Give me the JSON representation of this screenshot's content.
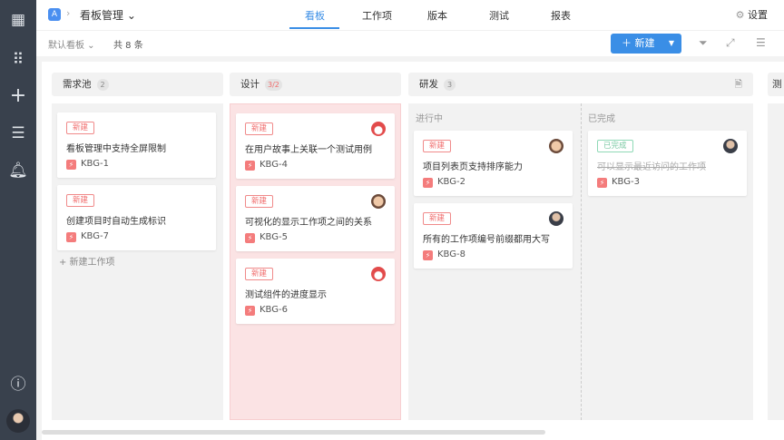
{
  "sidebar": {
    "items": [
      "dashboard-icon",
      "apps-icon",
      "add-icon",
      "list-icon",
      "bell-icon",
      "help-icon"
    ]
  },
  "header": {
    "logo": "A",
    "title": "看板管理",
    "tabs": [
      "看板",
      "工作项",
      "版本",
      "测试",
      "报表"
    ],
    "settings": "设置"
  },
  "toolbar": {
    "view": "默认看板",
    "count": "共 8 条",
    "new": "新建"
  },
  "columns": [
    {
      "title": "需求池",
      "badge": "2",
      "add": "+ 新建工作项",
      "cards": [
        {
          "status": "新建",
          "title": "看板管理中支持全屏限制",
          "id": "KBG-1"
        },
        {
          "status": "新建",
          "title": "创建项目时自动生成标识",
          "id": "KBG-7"
        }
      ]
    },
    {
      "title": "设计",
      "badge": "3/2",
      "cards": [
        {
          "status": "新建",
          "title": "在用户故事上关联一个测试用例",
          "id": "KBG-4"
        },
        {
          "status": "新建",
          "title": "可视化的显示工作项之间的关系",
          "id": "KBG-5"
        },
        {
          "status": "新建",
          "title": "测试组件的进度显示",
          "id": "KBG-6"
        }
      ]
    },
    {
      "title": "研发",
      "badge": "3",
      "sub": [
        "进行中",
        "已完成"
      ],
      "cards": [
        {
          "status": "新建",
          "title": "项目列表页支持排序能力",
          "id": "KBG-2"
        },
        {
          "status": "新建",
          "title": "所有的工作项编号前缀都用大写",
          "id": "KBG-8"
        },
        {
          "status": "已完成",
          "title": "可以显示最近访问的工作项",
          "id": "KBG-3"
        }
      ]
    },
    {
      "title": "测"
    }
  ],
  "colors": {
    "accent": "#3a8ee6",
    "sidebar": "#39414d",
    "wip_exceeded": "#fbe3e4"
  }
}
